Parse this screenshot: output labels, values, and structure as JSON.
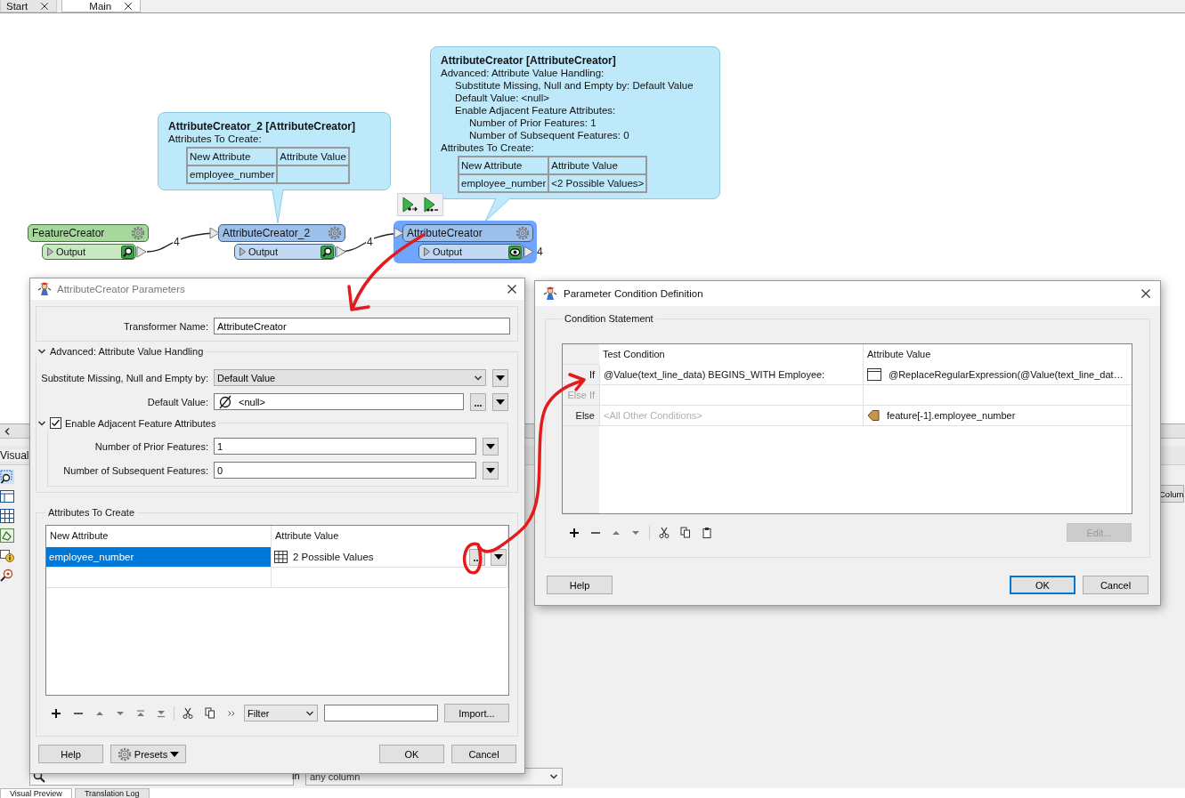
{
  "tabs": [
    {
      "label": "Start",
      "selected": false
    },
    {
      "label": "Main",
      "selected": true
    }
  ],
  "canvas": {
    "callouts": [
      {
        "title": "AttributeCreator_2 [AttributeCreator]",
        "lines": [
          {
            "text": "Attributes To Create:"
          }
        ],
        "table": {
          "columns": [
            "New Attribute",
            "Attribute Value"
          ],
          "rows": [
            [
              "employee_number"
            ]
          ]
        }
      },
      {
        "title": "AttributeCreator [AttributeCreator]",
        "lines": [
          {
            "text": "Advanced: Attribute Value Handling:",
            "children": [
              {
                "text": "Substitute Missing, Null and Empty by: Default Value"
              },
              {
                "text": "Default Value: <null>"
              },
              {
                "text": "Enable Adjacent Feature Attributes:",
                "children": [
                  {
                    "text": "Number of Prior Features: 1"
                  },
                  {
                    "text": "Number of Subsequent Features: 0"
                  }
                ]
              }
            ]
          },
          {
            "text": "Attributes To Create:"
          }
        ],
        "table": {
          "columns": [
            "New Attribute",
            "Attribute Value"
          ],
          "rows": [
            [
              "employee_number",
              "<2 Possible Values>"
            ]
          ]
        }
      }
    ],
    "nodes": [
      {
        "name": "FeatureCreator",
        "kind": "creator",
        "has_input": false,
        "port": "Output",
        "viewer": {
          "kind": "search"
        },
        "count": "4",
        "selected": false
      },
      {
        "name": "AttributeCreator_2",
        "kind": "transformer",
        "has_input": true,
        "port": "Output",
        "viewer": {
          "kind": "search"
        },
        "count": "4",
        "selected": false
      },
      {
        "name": "AttributeCreator",
        "kind": "transformer",
        "has_input": true,
        "port": "Output",
        "viewer": {
          "kind": "eye"
        },
        "count": "4",
        "selected": true
      }
    ]
  },
  "workspace": {
    "side_label": "Visual",
    "column_button": "Colum",
    "search_scope_label": "in",
    "search_scope": "any column",
    "bottom_tabs": [
      {
        "label": "Visual Preview",
        "selected": true
      },
      {
        "label": "Translation Log",
        "selected": false
      }
    ]
  },
  "parameters_dialog": {
    "title": "AttributeCreator Parameters",
    "transformer_name": {
      "label": "Transformer Name:",
      "value": "AttributeCreator"
    },
    "advanced": {
      "title": "Advanced: Attribute Value Handling",
      "expanded": true,
      "substitute": {
        "label": "Substitute Missing, Null and Empty by:",
        "value": "Default Value"
      },
      "default_value": {
        "label": "Default Value:",
        "value": "<null>"
      },
      "adjacent": {
        "title": "Enable Adjacent Feature Attributes",
        "expanded": true,
        "checked": true,
        "fields": [
          {
            "label": "Number of Prior Features:",
            "value": "1"
          },
          {
            "label": "Number of Subsequent Features:",
            "value": "0"
          }
        ]
      }
    },
    "attributes": {
      "title": "Attributes To Create",
      "columns": [
        "New Attribute",
        "Attribute Value"
      ],
      "rows": [
        {
          "name": "employee_number",
          "value": "2 Possible Values",
          "selected": true
        }
      ]
    },
    "filter": "Filter",
    "import_button": "Import...",
    "buttons": {
      "help": "Help",
      "presets": "Presets",
      "ok": "OK",
      "cancel": "Cancel"
    }
  },
  "condition_dialog": {
    "title": "Parameter Condition Definition",
    "group": "Condition Statement",
    "columns": [
      "Test Condition",
      "Attribute Value"
    ],
    "rows": [
      {
        "label": "If",
        "disabled": false,
        "condition": "@Value(text_line_data) BEGINS_WITH Employee:",
        "value": {
          "text": "@ReplaceRegularExpression(@Value(text_line_dat…",
          "kind": "expression"
        }
      },
      {
        "label": "Else If",
        "disabled": true
      },
      {
        "label": "Else",
        "disabled": false,
        "condition_placeholder": "<All Other Conditions>",
        "value": {
          "text": "feature[-1].employee_number",
          "kind": "attribute"
        }
      }
    ],
    "edit_button": {
      "label": "Edit...",
      "disabled": true
    },
    "buttons": {
      "help": "Help",
      "ok": "OK",
      "cancel": "Cancel"
    }
  },
  "annotations": [
    {
      "kind": "arrow"
    },
    {
      "kind": "loop_arrow"
    }
  ]
}
